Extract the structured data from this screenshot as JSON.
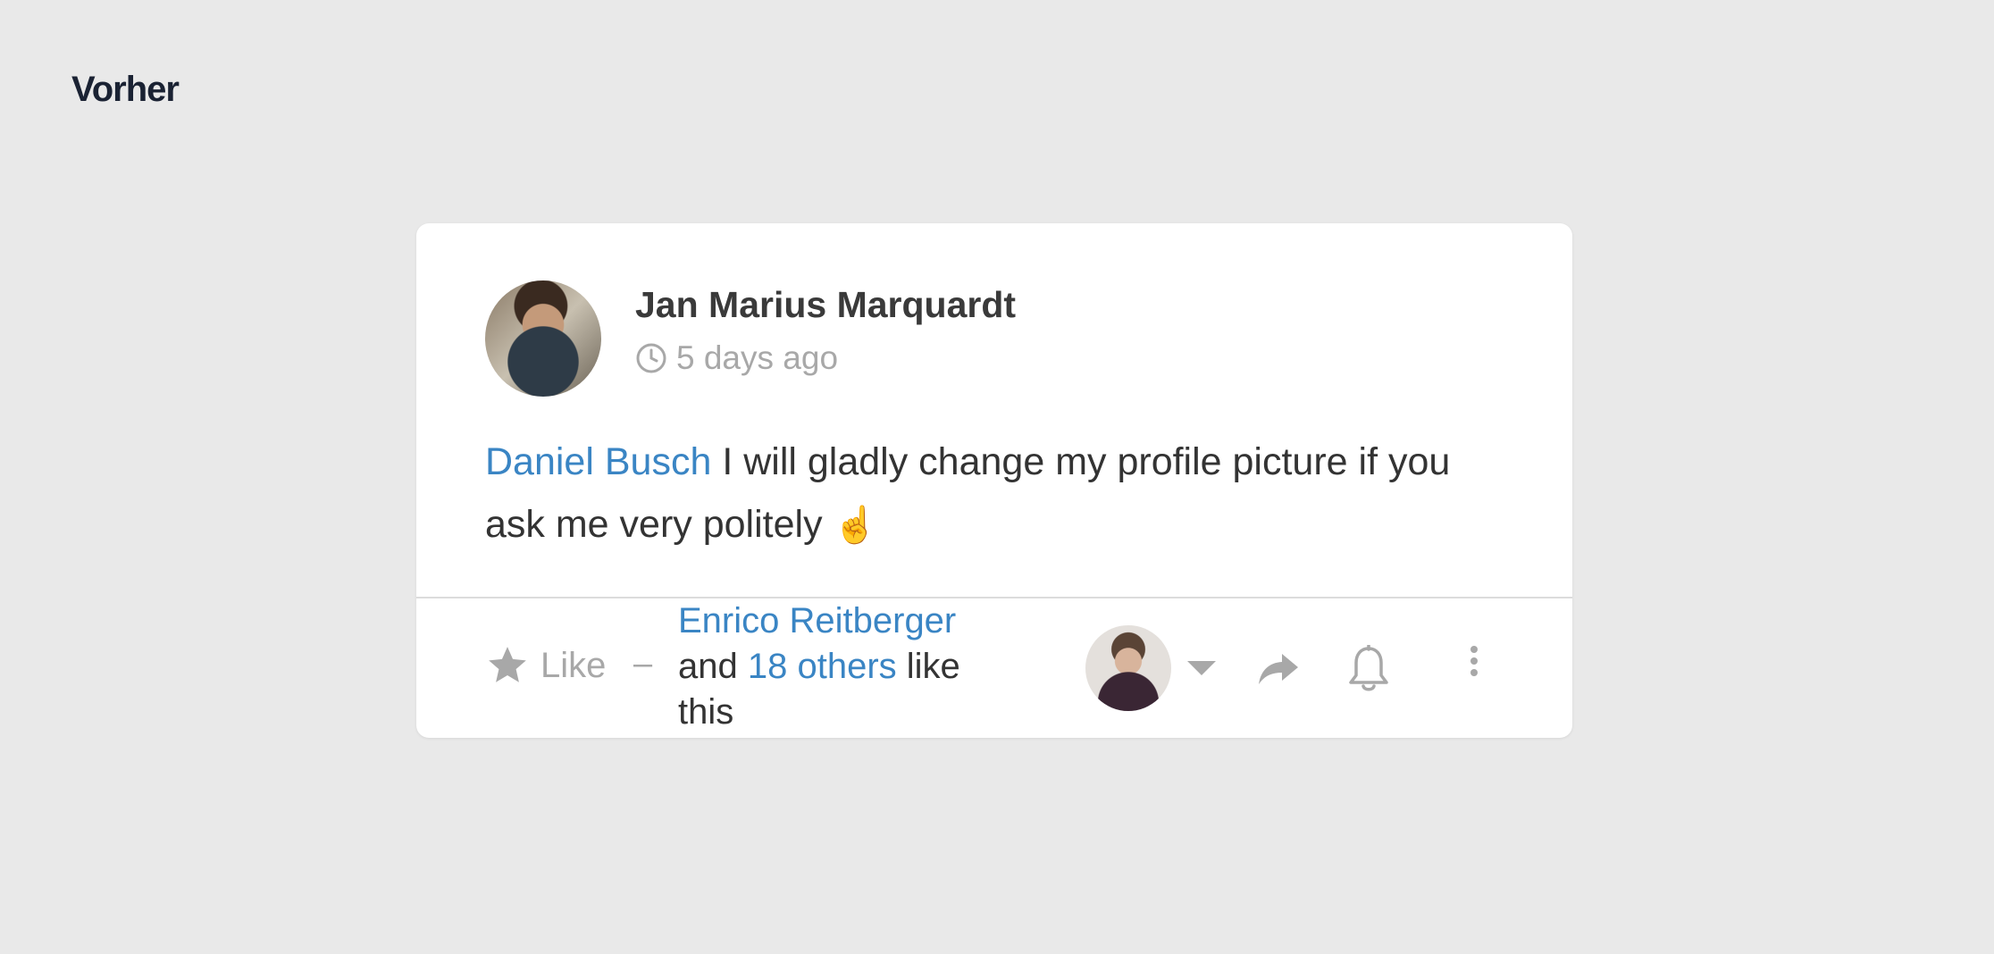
{
  "page": {
    "heading": "Vorher"
  },
  "post": {
    "author": "Jan Marius Marquardt",
    "timestamp": "5 days ago",
    "mention": "Daniel Busch",
    "text": " I will gladly change my profile picture if you ask me very politely ",
    "emoji": "☝️"
  },
  "footer": {
    "like_label": "Like",
    "separator": "–",
    "liker_name": "Enrico Reitberger",
    "and_text": "and ",
    "others_link": "18 others",
    "like_suffix": " like this"
  },
  "icons": {
    "clock": "clock-icon",
    "star": "star-icon",
    "dropdown": "chevron-down-icon",
    "share": "share-icon",
    "bell": "bell-icon",
    "more": "more-vertical-icon"
  },
  "colors": {
    "background": "#e9e9e9",
    "card": "#ffffff",
    "link": "#3a85c4",
    "muted": "#a8a8a8",
    "text": "#333333"
  }
}
